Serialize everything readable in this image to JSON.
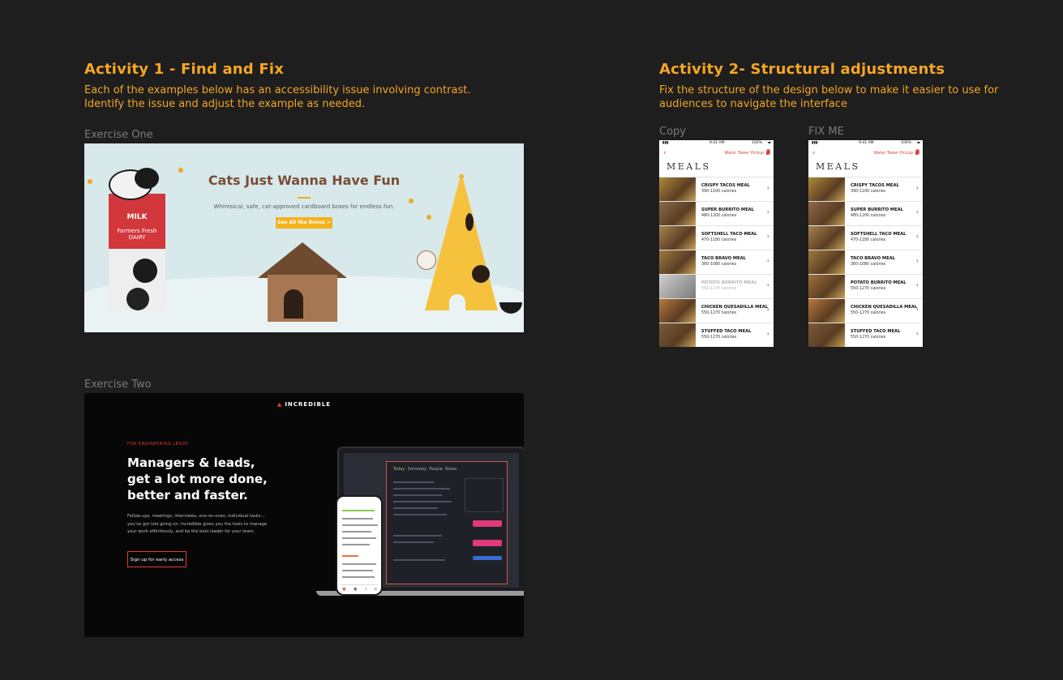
{
  "activity1": {
    "title": "Activity 1 - Find and Fix",
    "description": "Each of the examples below has an accessibility issue involving contrast. Identify the issue and adjust the example as needed."
  },
  "activity2": {
    "title": "Activity 2- Structural adjustments",
    "description": "Fix the structure of the design below to make it easier to use for audiences to navigate the interface"
  },
  "exercise_one": {
    "caption": "Exercise One",
    "banner": {
      "title": "Cats Just Wanna Have Fun",
      "subtitle": "Whimsical, safe,  cat-approved cardboard boxes for endless fun.",
      "button": "See All the Boxes >",
      "milk_label": "MILK",
      "dairy_label": "Farmers Fresh DAIRY",
      "colors": {
        "background": "#d7e9ea",
        "title": "#7a4c37",
        "button": "#f5b21c"
      }
    }
  },
  "exercise_two": {
    "caption": "Exercise Two",
    "brand": "INCREDIBLE",
    "eyebrow": "FOR ENGINEERING LEADS",
    "headline": "Managers & leads, get a lot more done, better and faster.",
    "paragraph": "Follow-ups, meetings, interviews, one-on-ones, individual tasks... you've got lots going on. Incredible gives you the tools to manage your work effortlessly, and be the best leader for your team.",
    "cta": "Sign up for early access",
    "app_tabs": [
      "Today",
      "Someday",
      "People",
      "Notes"
    ]
  },
  "mockups": [
    {
      "caption": "Copy",
      "time": "9:41 AM",
      "battery": "100%",
      "location": "Water Tower Pickup",
      "heading": "MEALS",
      "items": [
        {
          "name": "CRISPY TACOS MEAL",
          "calories": "390-1100 calories",
          "faded": false,
          "color": "#b08a3c"
        },
        {
          "name": "SUPER BURRITO MEAL",
          "calories": "480-1200 calories",
          "faded": false,
          "color": "#8b6a4a"
        },
        {
          "name": "SOFTSHELL TACO MEAL",
          "calories": "470-1180 calories",
          "faded": false,
          "color": "#a8824f"
        },
        {
          "name": "TACO BRAVO MEAL",
          "calories": "360-1080 calories",
          "faded": false,
          "color": "#9b7a3e"
        },
        {
          "name": "POTATO BURRITO MEAL",
          "calories": "550-1270 calories",
          "faded": true,
          "color": "#9e9e9e"
        },
        {
          "name": "CHICKEN QUESADILLA MEAL",
          "calories": "550-1270 calories",
          "faded": false,
          "color": "#b9773b"
        },
        {
          "name": "STUFFED TACO MEAL",
          "calories": "550-1270 calories",
          "faded": false,
          "color": "#7a5a3a"
        }
      ]
    },
    {
      "caption": "FIX ME",
      "time": "9:41 AM",
      "battery": "100%",
      "location": "Water Tower Pickup",
      "heading": "MEALS",
      "items": [
        {
          "name": "CRISPY TACOS MEAL",
          "calories": "390-1100 calories",
          "faded": false,
          "color": "#b08a3c"
        },
        {
          "name": "SUPER BURRITO MEAL",
          "calories": "480-1200 calories",
          "faded": false,
          "color": "#8b6a4a"
        },
        {
          "name": "SOFTSHELL TACO MEAL",
          "calories": "470-1180 calories",
          "faded": false,
          "color": "#a8824f"
        },
        {
          "name": "TACO BRAVO MEAL",
          "calories": "360-1080 calories",
          "faded": false,
          "color": "#9b7a3e"
        },
        {
          "name": "POTATO BURRITO MEAL",
          "calories": "550-1270 calories",
          "faded": false,
          "color": "#a0713c"
        },
        {
          "name": "CHICKEN QUESADILLA MEAL",
          "calories": "550-1270 calories",
          "faded": false,
          "color": "#b9773b"
        },
        {
          "name": "STUFFED TACO MEAL",
          "calories": "550-1270 calories",
          "faded": false,
          "color": "#7a5a3a"
        }
      ]
    }
  ],
  "colors": {
    "canvas": "#1e1e1e",
    "heading": "#f5a623",
    "caption": "#7b7b7b",
    "accent_red": "#e53935"
  }
}
